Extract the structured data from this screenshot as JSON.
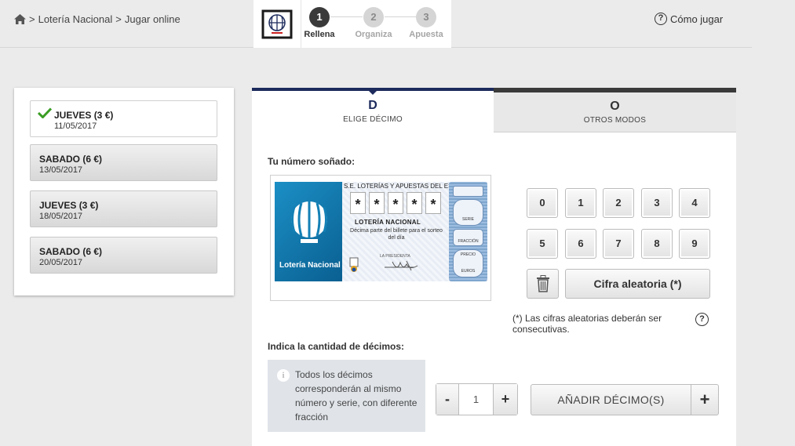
{
  "breadcrumb": {
    "home_icon": "home-icon",
    "sep1": ">",
    "item1": "Lotería Nacional",
    "sep2": ">",
    "item2": "Jugar online"
  },
  "steps": [
    {
      "num": "1",
      "label": "Rellena",
      "state": "active"
    },
    {
      "num": "2",
      "label": "Organiza",
      "state": "inactive"
    },
    {
      "num": "3",
      "label": "Apuesta",
      "state": "inactive"
    }
  ],
  "how_to_play": {
    "icon": "question-icon",
    "q": "?",
    "label": "Cómo jugar"
  },
  "draws": [
    {
      "day": "JUEVES (3 €)",
      "date": "11/05/2017",
      "selected": true
    },
    {
      "day": "SABADO (6 €)",
      "date": "13/05/2017",
      "selected": false
    },
    {
      "day": "JUEVES (3 €)",
      "date": "18/05/2017",
      "selected": false
    },
    {
      "day": "SABADO (6 €)",
      "date": "20/05/2017",
      "selected": false
    }
  ],
  "tabs": {
    "d": {
      "letter": "D",
      "label": "ELIGE DÉCIMO",
      "active": true
    },
    "o": {
      "letter": "O",
      "label": "OTROS MODOS",
      "active": false
    }
  },
  "dream_number_label": "Tu número soñado:",
  "ticket": {
    "brand": "Lotería Nacional",
    "org": "S.E. LOTERÍAS Y APUESTAS DEL ESTADO",
    "digits": [
      "*",
      "*",
      "*",
      "*",
      "*"
    ],
    "title": "LOTERÍA NACIONAL",
    "desc": "Décima parte del billete para el sorteo del día",
    "president": "LA PRESIDENTA",
    "serie": "SERIE",
    "fraccion": "FRACCIÓN",
    "precio": "PRECIO",
    "euros": "EUROS"
  },
  "keypad": {
    "row1": [
      "0",
      "1",
      "2",
      "3",
      "4"
    ],
    "row2": [
      "5",
      "6",
      "7",
      "8",
      "9"
    ],
    "random_label": "Cifra aleatoria (*)"
  },
  "random_note": "(*) Las cifras aleatorias deberán ser consecutivas.",
  "note_help": "?",
  "quantity_label": "Indica la cantidad de décimos:",
  "info_text": "Todos los décimos corresponderán al mismo número y serie, con diferente fracción",
  "info_icon": "i",
  "stepper": {
    "minus": "-",
    "value": "1",
    "plus": "+"
  },
  "add_button": {
    "label": "AÑADIR DÉCIMO(S)",
    "plus": "+"
  },
  "colors": {
    "navy": "#1c2a5c",
    "ticket_blue": "#1b8fc5",
    "check_green": "#3a9d23"
  }
}
